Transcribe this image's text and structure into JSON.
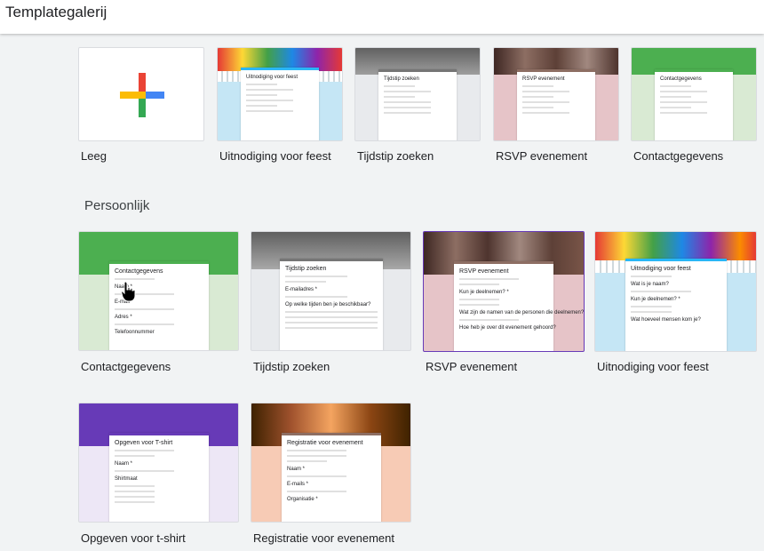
{
  "header": {
    "title": "Templategalerij"
  },
  "sections": {
    "personal_title": "Persoonlijk"
  },
  "top_row": [
    {
      "label": "Leeg"
    },
    {
      "label": "Uitnodiging voor feest",
      "form_title": "Uitnodiging voor feest"
    },
    {
      "label": "Tijdstip zoeken",
      "form_title": "Tijdstip zoeken"
    },
    {
      "label": "RSVP evenement",
      "form_title": "RSVP evenement"
    },
    {
      "label": "Contactgegevens",
      "form_title": "Contactgegevens"
    }
  ],
  "personal_row1": [
    {
      "label": "Contactgegevens",
      "form_title": "Contactgegevens",
      "fields": [
        "Naam *",
        "E-mail *",
        "Adres *",
        "Telefoonnummer"
      ]
    },
    {
      "label": "Tijdstip zoeken",
      "form_title": "Tijdstip zoeken",
      "fields": [
        "E-mailadres *",
        "Op welke tijden ben je beschikbaar?"
      ]
    },
    {
      "label": "RSVP evenement",
      "form_title": "RSVP evenement",
      "fields": [
        "Kun je deelnemen? *",
        "Wat zijn de namen van de personen die deelnemen?",
        "Hoe heb je over dit evenement gehoord?"
      ]
    },
    {
      "label": "Uitnodiging voor feest",
      "form_title": "Uitnodiging voor feest",
      "fields": [
        "Wat is je naam?",
        "Kun je deelnemen? *",
        "Wat hoeveel mensen kom je?"
      ]
    }
  ],
  "personal_row2": [
    {
      "label": "Opgeven voor t-shirt",
      "form_title": "Opgeven voor T-shirt",
      "fields": [
        "Naam *",
        "Shirtmaat"
      ]
    },
    {
      "label": "Registratie voor evenement",
      "form_title": "Registratie voor evenement",
      "fields": [
        "Naam *",
        "E-mails *",
        "Organisatie *"
      ]
    }
  ],
  "colors": {
    "green": "#4caf50",
    "green_light": "#d9ead3",
    "purple": "#673ab7",
    "purple_light": "#ede7f6",
    "blue_light": "#c5e6f5",
    "pink_light": "#e6c4c8",
    "peach": "#f7cbb5",
    "gray_light": "#e8eaed"
  }
}
